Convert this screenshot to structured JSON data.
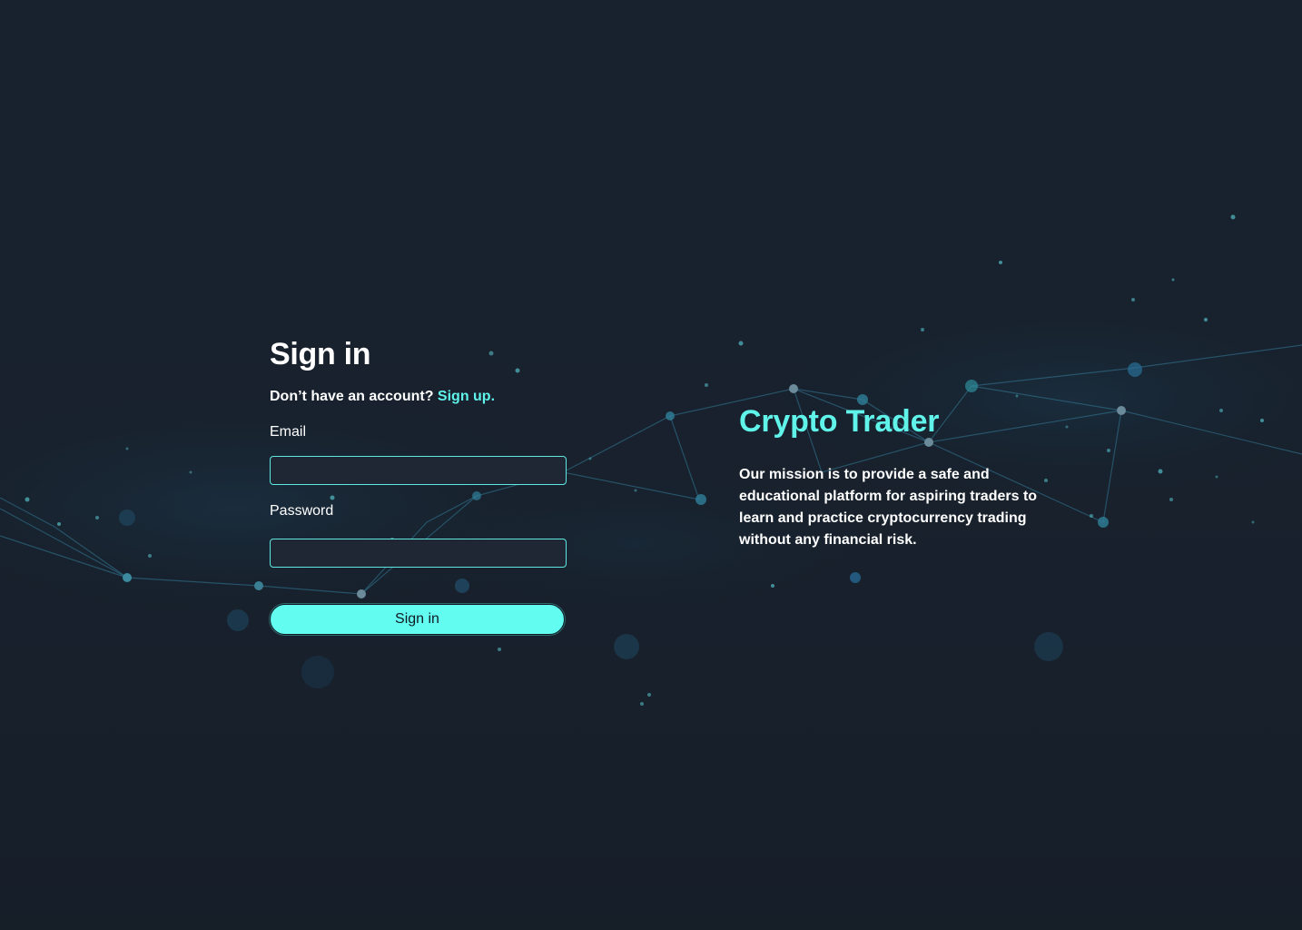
{
  "signin": {
    "title": "Sign in",
    "account_prompt": "Don’t have an account?",
    "signup_link": "Sign up.",
    "email_label": "Email",
    "email_value": "",
    "password_label": "Password",
    "password_value": "",
    "submit_label": "Sign in"
  },
  "brand": {
    "name": "Crypto Trader",
    "mission": "Our mission is to provide a safe and educational platform for aspiring traders to learn and practice cryptocurrency trading without any financial risk."
  },
  "colors": {
    "background": "#18222e",
    "accent": "#5ff3ea",
    "input_background": "#1f2735",
    "button_background": "#62fdf0"
  }
}
